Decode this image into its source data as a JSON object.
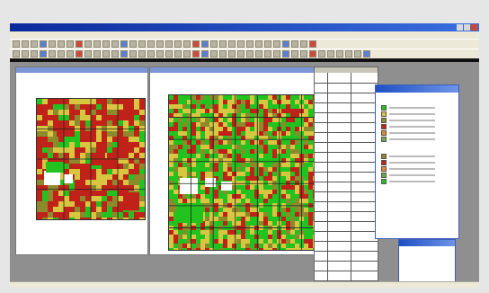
{
  "colors": {
    "background": "#e6e6e6",
    "workspace": "#8f8f8f",
    "titlebar": "#0a2a9a",
    "map_green": "#22c21f",
    "map_red": "#c0221a",
    "map_yellow": "#d9c640",
    "map_olive": "#8d8a2c"
  },
  "icons": [
    "window-minimize-icon",
    "window-maximize-icon",
    "window-close-icon",
    "toolbar-tool-icon"
  ],
  "table": {
    "rows": 22,
    "columns": 3
  },
  "legend": {
    "groups": [
      {
        "items": 6
      },
      {
        "items": 5
      }
    ]
  }
}
